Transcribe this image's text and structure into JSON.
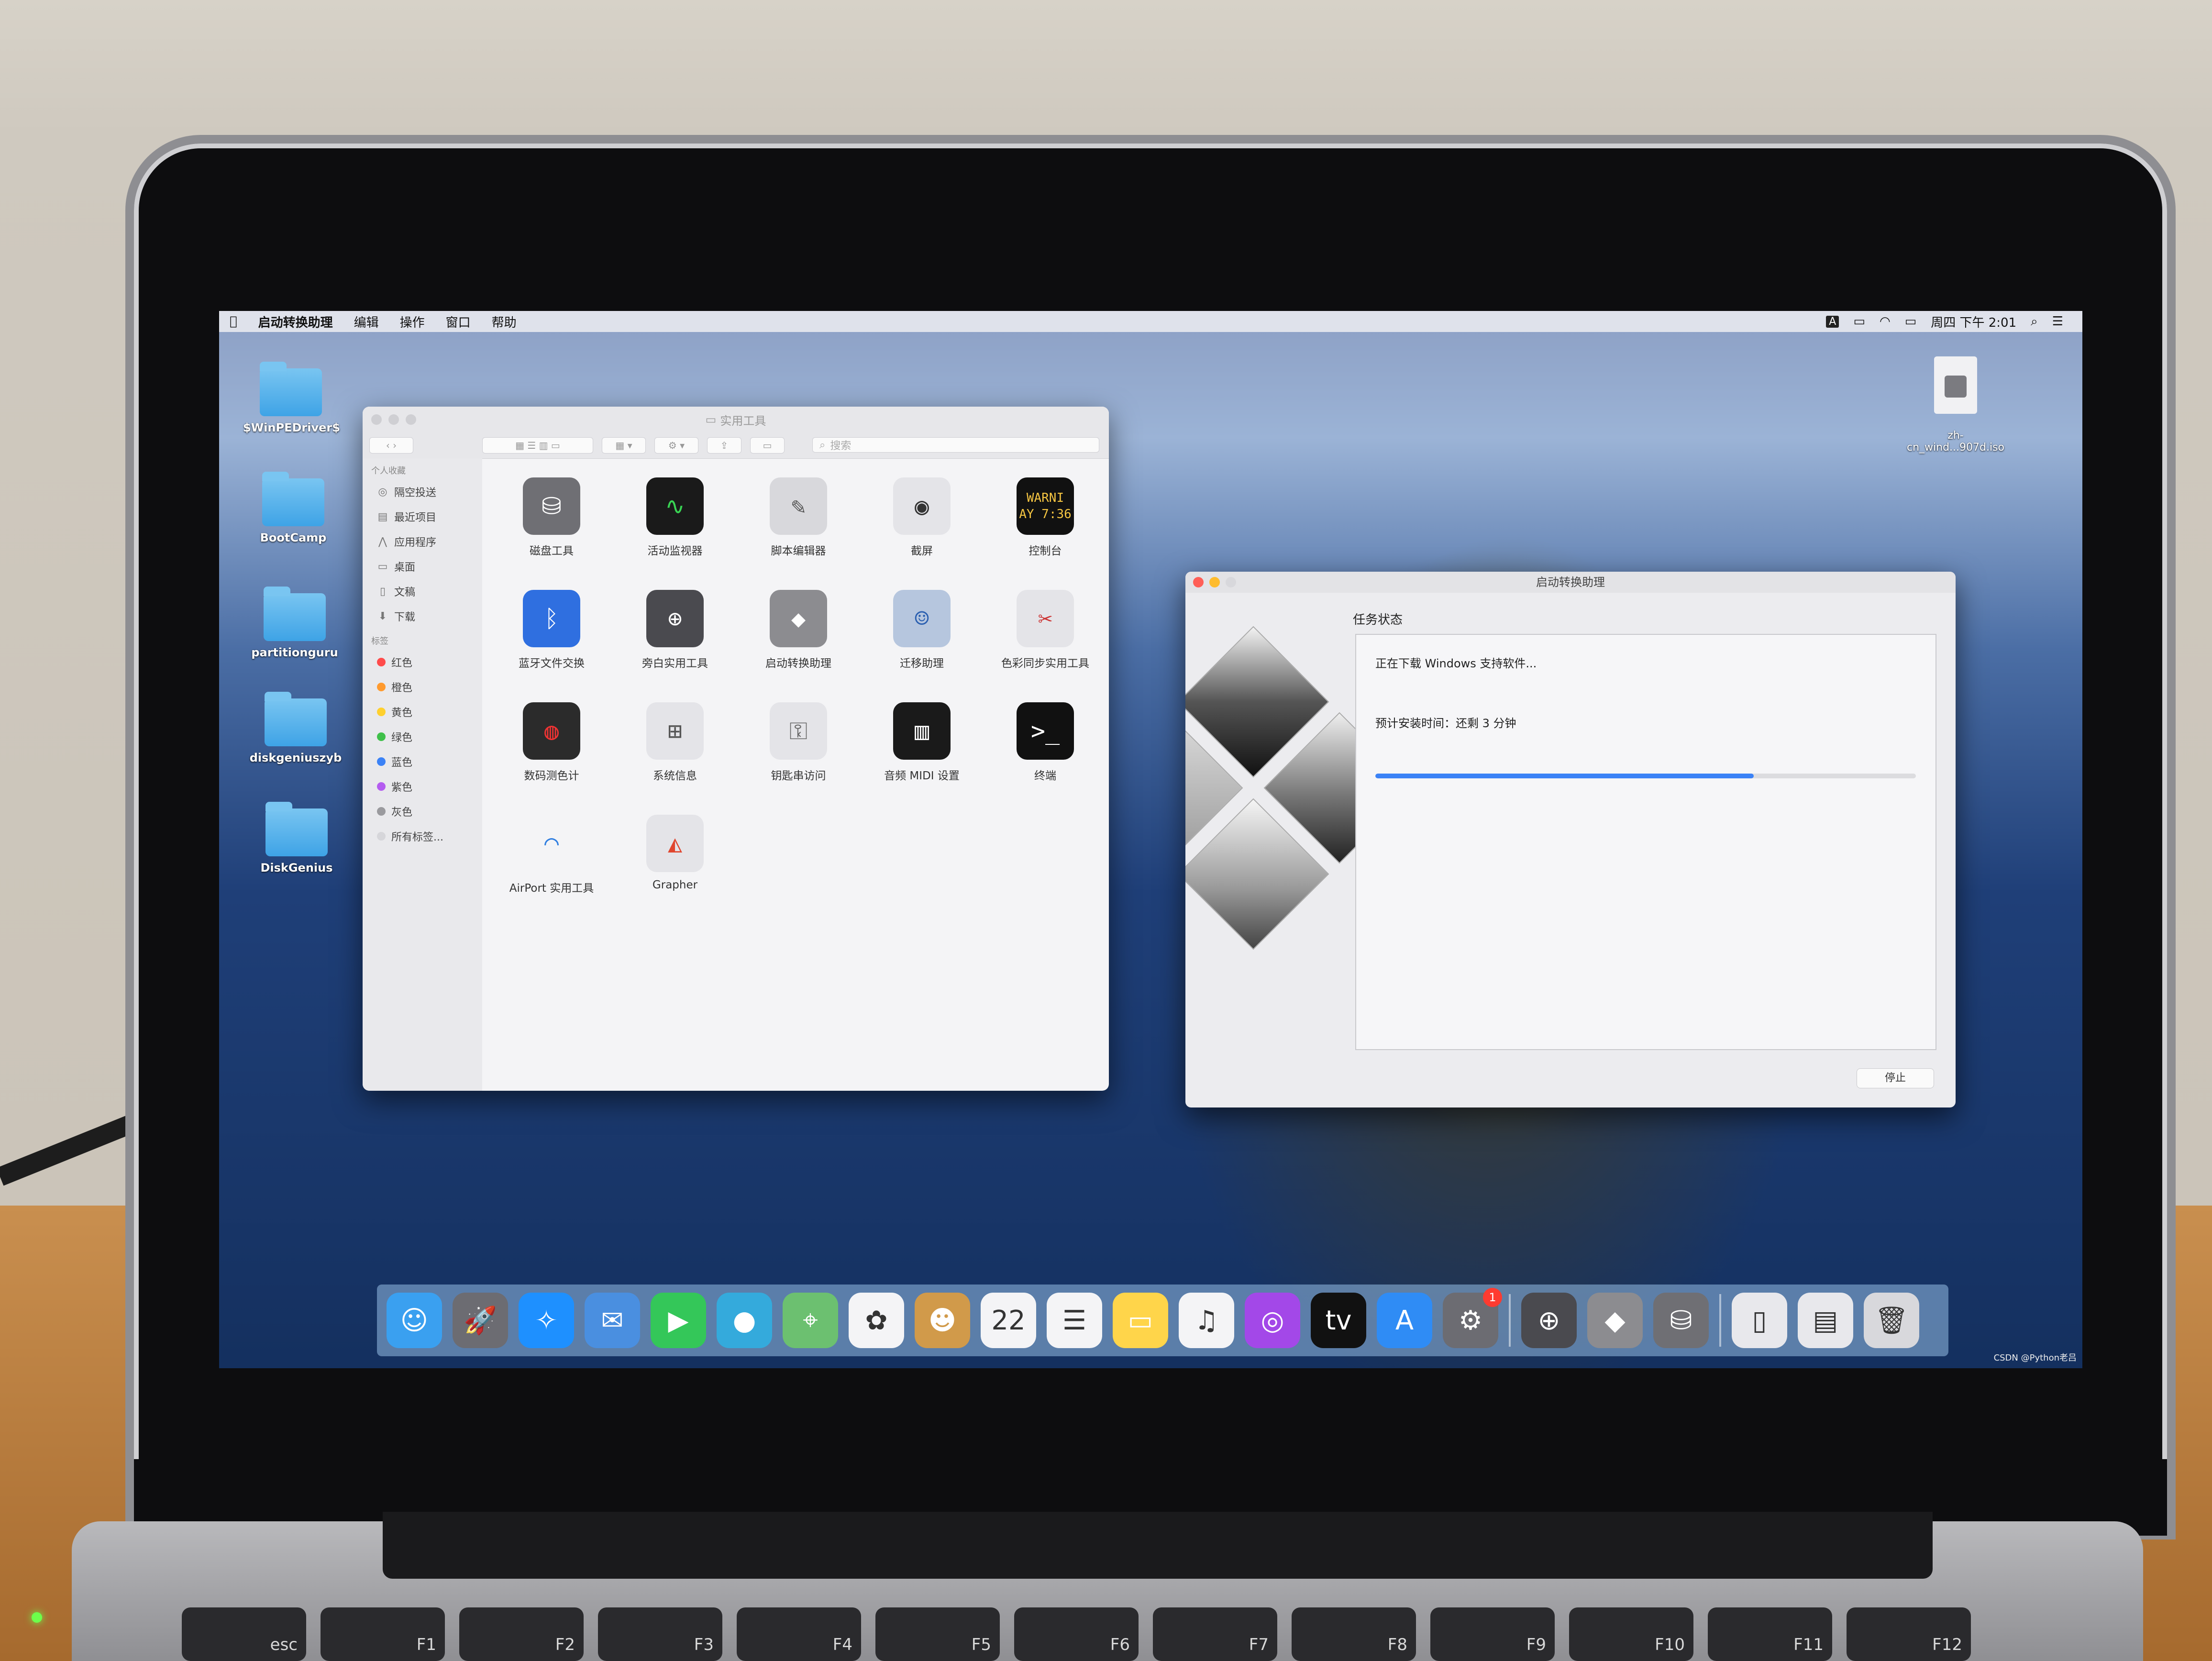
{
  "menubar": {
    "apple_icon": "apple-icon",
    "app_name": "启动转换助理",
    "menus": [
      "编辑",
      "操作",
      "窗口",
      "帮助"
    ],
    "status": {
      "input_method": "A",
      "clock": "周四 下午 2:01"
    }
  },
  "desktop_icons": [
    {
      "label": "$WinPEDriver$"
    },
    {
      "label": "BootCamp"
    },
    {
      "label": "partitionguru"
    },
    {
      "label": "diskgeniuszyb"
    },
    {
      "label": "DiskGenius"
    },
    {
      "label": "zh-\ncn_wind...907d.iso"
    }
  ],
  "finder": {
    "title": "实用工具",
    "search_placeholder": "搜索",
    "sidebar": {
      "favorites_header": "个人收藏",
      "favorites": [
        {
          "label": "隔空投送",
          "icon": "airdrop-icon",
          "glyph": "◎"
        },
        {
          "label": "最近项目",
          "icon": "recents-icon",
          "glyph": "▤"
        },
        {
          "label": "应用程序",
          "icon": "applications-icon",
          "glyph": "⋀"
        },
        {
          "label": "桌面",
          "icon": "desktop-icon",
          "glyph": "▭"
        },
        {
          "label": "文稿",
          "icon": "documents-icon",
          "glyph": "▯"
        },
        {
          "label": "下载",
          "icon": "downloads-icon",
          "glyph": "⬇"
        }
      ],
      "tags_header": "标签",
      "tags": [
        {
          "label": "红色",
          "color": "#ff4b4b"
        },
        {
          "label": "橙色",
          "color": "#ff9a2e"
        },
        {
          "label": "黄色",
          "color": "#ffd02e"
        },
        {
          "label": "绿色",
          "color": "#3fc04a"
        },
        {
          "label": "蓝色",
          "color": "#3b82f6"
        },
        {
          "label": "紫色",
          "color": "#b45cf0"
        },
        {
          "label": "灰色",
          "color": "#9a9a9e"
        },
        {
          "label": "所有标签...",
          "color": "#d6d6da"
        }
      ]
    },
    "apps": [
      {
        "label": "磁盘工具",
        "icon": "disk-utility-icon",
        "glyph": "⛁",
        "bg": "#6f6f74",
        "fg": "#fff"
      },
      {
        "label": "活动监视器",
        "icon": "activity-monitor-icon",
        "glyph": "∿",
        "bg": "#1a1a1a",
        "fg": "#39d353"
      },
      {
        "label": "脚本编辑器",
        "icon": "script-editor-icon",
        "glyph": "✎",
        "bg": "#d8d8dc",
        "fg": "#555"
      },
      {
        "label": "截屏",
        "icon": "screenshot-icon",
        "glyph": "◉",
        "bg": "#e4e4e8",
        "fg": "#333"
      },
      {
        "label": "控制台",
        "icon": "console-icon",
        "glyph": "WARNI\nAY 7:36",
        "bg": "#111",
        "fg": "#f5c542"
      },
      {
        "label": "蓝牙文件交换",
        "icon": "bluetooth-icon",
        "glyph": "ᛒ",
        "bg": "#2f6fe0",
        "fg": "#fff"
      },
      {
        "label": "旁白实用工具",
        "icon": "voiceover-icon",
        "glyph": "⊕",
        "bg": "#4a4a4f",
        "fg": "#fff"
      },
      {
        "label": "启动转换助理",
        "icon": "boot-camp-icon",
        "glyph": "◆",
        "bg": "#8c8c90",
        "fg": "#fff"
      },
      {
        "label": "迁移助理",
        "icon": "migration-icon",
        "glyph": "☺",
        "bg": "#b6c6de",
        "fg": "#2a5fb0"
      },
      {
        "label": "色彩同步实用工具",
        "icon": "colorsync-icon",
        "glyph": "✂",
        "bg": "#e4e4e8",
        "fg": "#c33"
      },
      {
        "label": "数码测色计",
        "icon": "color-meter-icon",
        "glyph": "◍",
        "bg": "#2b2b2b",
        "fg": "#e33"
      },
      {
        "label": "系统信息",
        "icon": "system-info-icon",
        "glyph": "⊞",
        "bg": "#e4e4e8",
        "fg": "#555"
      },
      {
        "label": "钥匙串访问",
        "icon": "keychain-icon",
        "glyph": "⚿",
        "bg": "#e4e4e8",
        "fg": "#666"
      },
      {
        "label": "音频 MIDI 设置",
        "icon": "midi-icon",
        "glyph": "▥",
        "bg": "#1a1a1a",
        "fg": "#fff"
      },
      {
        "label": "终端",
        "icon": "terminal-icon",
        "glyph": ">_",
        "bg": "#111",
        "fg": "#fff"
      },
      {
        "label": "AirPort 实用工具",
        "icon": "airport-icon",
        "glyph": "◠",
        "bg": "#f4f4f6",
        "fg": "#2f7ee0"
      },
      {
        "label": "Grapher",
        "icon": "grapher-icon",
        "glyph": "◭",
        "bg": "#e4e4e8",
        "fg": "#e0462f"
      }
    ]
  },
  "bootcamp": {
    "title": "启动转换助理",
    "task_status": "任务状态",
    "status_line": "正在下载 Windows 支持软件...",
    "time_line": "预计安装时间：还剩 3 分钟",
    "progress_percent": 70,
    "stop_label": "停止"
  },
  "dock": [
    {
      "icon": "finder-icon",
      "glyph": "☺",
      "bg": "#3aa0f0",
      "running": true
    },
    {
      "icon": "launchpad-icon",
      "glyph": "🚀",
      "bg": "#6c6c72",
      "running": false
    },
    {
      "icon": "safari-icon",
      "glyph": "✧",
      "bg": "#1e90ff",
      "running": true
    },
    {
      "icon": "mail-icon",
      "glyph": "✉",
      "bg": "#4a8fe0",
      "running": false
    },
    {
      "icon": "facetime-icon",
      "glyph": "▶",
      "bg": "#34c759",
      "running": false
    },
    {
      "icon": "messages-icon",
      "glyph": "●",
      "bg": "#34aadc",
      "running": false
    },
    {
      "icon": "maps-icon",
      "glyph": "⌖",
      "bg": "#6cc070",
      "running": false
    },
    {
      "icon": "photos-icon",
      "glyph": "✿",
      "bg": "#f4f4f6",
      "running": false
    },
    {
      "icon": "contacts-icon",
      "glyph": "☻",
      "bg": "#d19a4a",
      "running": false
    },
    {
      "icon": "calendar-icon",
      "glyph": "22",
      "bg": "#f4f4f6",
      "running": false
    },
    {
      "icon": "reminders-icon",
      "glyph": "☰",
      "bg": "#f4f4f6",
      "running": false
    },
    {
      "icon": "notes-icon",
      "glyph": "▭",
      "bg": "#ffd54a",
      "running": false
    },
    {
      "icon": "music-icon",
      "glyph": "♫",
      "bg": "#f4f4f6",
      "running": false
    },
    {
      "icon": "podcasts-icon",
      "glyph": "◎",
      "bg": "#a348e8",
      "running": false
    },
    {
      "icon": "apple-tv-icon",
      "glyph": "tv",
      "bg": "#111",
      "running": false
    },
    {
      "icon": "app-store-icon",
      "glyph": "A",
      "bg": "#2f8cf5",
      "running": false
    },
    {
      "icon": "system-preferences-icon",
      "glyph": "⚙",
      "bg": "#6c6c72",
      "running": false,
      "badge": "1"
    },
    {
      "icon": "voiceover-dock-icon",
      "glyph": "⊕",
      "bg": "#4a4a4f",
      "running": false
    },
    {
      "icon": "boot-camp-dock-icon",
      "glyph": "◆",
      "bg": "#8c8c90",
      "running": true
    },
    {
      "icon": "disk-utility-dock-icon",
      "glyph": "⛁",
      "bg": "#6f6f74",
      "running": false
    },
    {
      "icon": "iso-file-icon",
      "glyph": "▯",
      "bg": "#e8e8ec",
      "running": false
    },
    {
      "icon": "downloads-stack-icon",
      "glyph": "▤",
      "bg": "#e8e8ec",
      "running": false
    },
    {
      "icon": "trash-icon",
      "glyph": "🗑",
      "bg": "#d8d8dc",
      "running": false
    }
  ],
  "keyboard": {
    "keys": [
      "esc",
      "F1",
      "F2",
      "F3",
      "F4",
      "F5",
      "F6",
      "F7",
      "F8",
      "F9",
      "F10",
      "F11",
      "F12"
    ]
  },
  "watermark": "CSDN @Python老吕"
}
